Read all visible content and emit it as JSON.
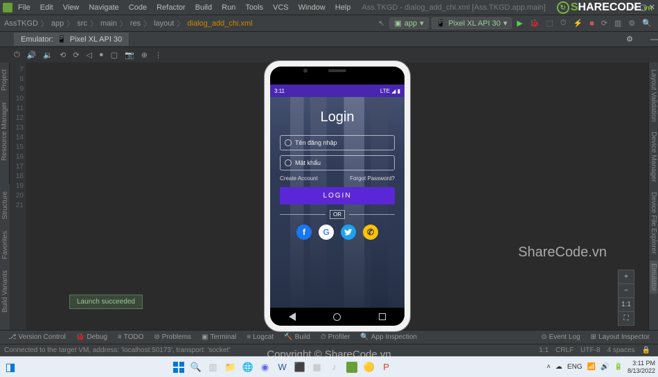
{
  "titlebar": {
    "project_title": "Ass.TKGD - dialog_add_chi.xml [Ass.TKGD.app.main]"
  },
  "menu": {
    "items": [
      "File",
      "Edit",
      "View",
      "Navigate",
      "Code",
      "Refactor",
      "Build",
      "Run",
      "Tools",
      "VCS",
      "Window",
      "Help"
    ]
  },
  "breadcrumbs": {
    "parts": [
      "AssTKGD",
      "app",
      "src",
      "main",
      "res",
      "layout"
    ],
    "file": "dialog_add_chi.xml"
  },
  "run": {
    "config": "app",
    "device": "Pixel XL API 30"
  },
  "tab": {
    "label": "Emulator:",
    "device": "Pixel XL API 30"
  },
  "linestart": 7,
  "lineend": 21,
  "phone": {
    "time": "3:11",
    "net": "LTE",
    "title": "Login",
    "username_ph": "Tên đăng nhập",
    "password_ph": "Mật khẩu",
    "create": "Create Account",
    "forgot": "Forgot Password?",
    "login_btn": "LOGIN",
    "or": "OR"
  },
  "left_tabs": [
    "Project",
    "Resource Manager"
  ],
  "left_tabs2": [
    "Build Variants",
    "Favorites",
    "Structure"
  ],
  "right_tabs": [
    "Emulator",
    "Device File Explorer",
    "Device Manager",
    "Layout Validation"
  ],
  "zoom": {
    "plus": "+",
    "minus": "−",
    "fit": "1:1",
    "expand": "⛶"
  },
  "toast": "Launch succeeded",
  "bottom_tabs": [
    "Version Control",
    "Debug",
    "TODO",
    "Problems",
    "Terminal",
    "Logcat",
    "Build",
    "Profiler",
    "App Inspection"
  ],
  "bottom_right": [
    "Event Log",
    "Layout Inspector"
  ],
  "status": {
    "msg": "Connected to the target VM, address: 'localhost:50173', transport: 'socket'",
    "pos": "1:1",
    "le": "CRLF",
    "enc": "UTF-8",
    "indent": "4 spaces"
  },
  "watermarks": {
    "main": "ShareCode.vn",
    "copy": "Copyright © ShareCode.vn",
    "logo_s": "S",
    "logo_rest": "HARECODE",
    "logo_vn": ".vn"
  },
  "taskbar": {
    "lang": "ENG",
    "time": "3:11 PM",
    "date": "8/13/2022"
  }
}
